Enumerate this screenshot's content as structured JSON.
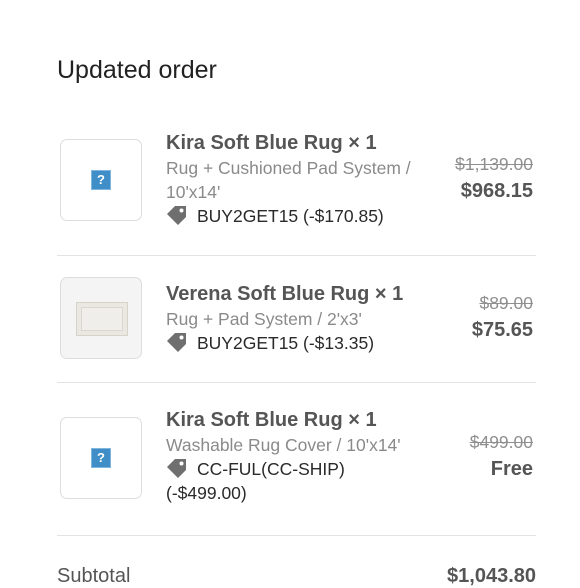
{
  "order": {
    "title": "Updated order",
    "items": [
      {
        "name": "Kira Soft Blue Rug × 1",
        "variant": "Rug + Cushioned Pad System / 10'x14'",
        "discount": "BUY2GET15 (-$170.85)",
        "original_price": "$1,139.00",
        "final_price": "$968.15",
        "image": "broken-image-icon"
      },
      {
        "name": "Verena Soft Blue Rug × 1",
        "variant": "Rug + Pad System / 2'x3'",
        "discount": "BUY2GET15 (-$13.35)",
        "original_price": "$89.00",
        "final_price": "$75.65",
        "image": "rug-thumbnail"
      },
      {
        "name": "Kira Soft Blue Rug × 1",
        "variant": "Washable Rug Cover / 10'x14'",
        "discount": "CC-FUL(CC-SHIP) (-$499.00)",
        "original_price": "$499.00",
        "final_price": "Free",
        "image": "broken-image-icon"
      }
    ],
    "subtotal_label": "Subtotal",
    "subtotal_value": "$1,043.80"
  }
}
